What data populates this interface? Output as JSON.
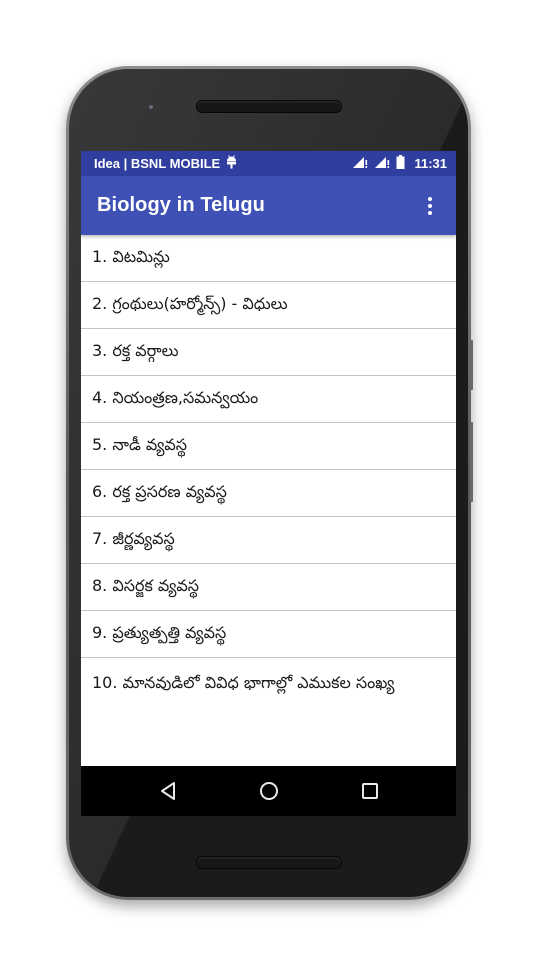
{
  "status_bar": {
    "carrier": "Idea | BSNL MOBILE",
    "time": "11:31",
    "icons": [
      "android-debug-icon",
      "signal-icon",
      "signal-icon",
      "battery-icon"
    ]
  },
  "toolbar": {
    "title": "Biology in Telugu",
    "menu_icon": "overflow-menu-icon"
  },
  "list": {
    "items": [
      {
        "label": "1. విటమిన్లు"
      },
      {
        "label": "2. గ్రంథులు(హర్మోన్స్) - విధులు"
      },
      {
        "label": "3. రక్త వర్గాలు"
      },
      {
        "label": "4. నియంత్రణ,సమన్వయం"
      },
      {
        "label": "5. నాడీ వ్యవస్థ"
      },
      {
        "label": "6. రక్త ప్రసరణ వ్యవస్థ"
      },
      {
        "label": "7. జీర్ణవ్యవస్థ"
      },
      {
        "label": "8. విసర్జక వ్యవస్థ"
      },
      {
        "label": "9. ప్రత్యుత్పత్తి వ్యవస్థ"
      },
      {
        "label": "10. మానవుడిలో వివిధ భాగాల్లో ఎముకల సంఖ్య"
      }
    ]
  },
  "nav_bar": {
    "back": "back-icon",
    "home": "home-icon",
    "recents": "recents-icon"
  },
  "colors": {
    "status_bar": "#303f9f",
    "toolbar": "#3f51b5",
    "divider": "#c4c4c4"
  }
}
